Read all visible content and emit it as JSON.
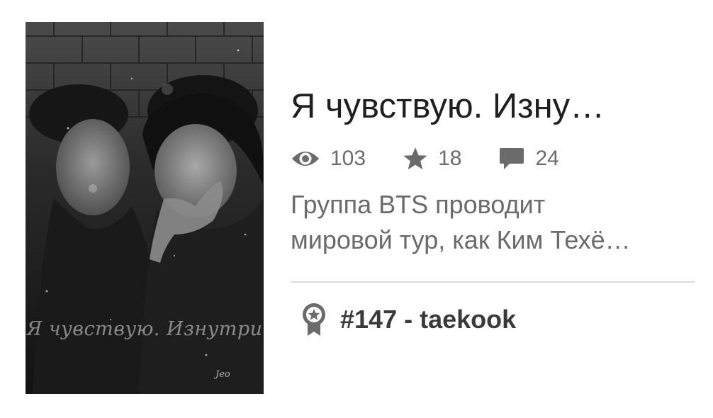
{
  "story": {
    "title": "Я чувствую. Изну…",
    "cover": {
      "title_text": "Я чувствую. Изнутри",
      "signature": "Jeo"
    },
    "stats": {
      "reads": "103",
      "votes": "18",
      "comments": "24"
    },
    "description_lines": [
      "Группа BTS проводит",
      "мировой тур, как Ким Техё…"
    ],
    "ranking": "#147 - taekook"
  },
  "icons": {
    "reads": "eye-icon",
    "votes": "star-icon",
    "comments": "speech-bubble-icon",
    "ranking": "award-badge-icon"
  },
  "colors": {
    "text_primary": "#1f1f1f",
    "text_secondary": "#6b6b6b",
    "divider": "#dcdcdc",
    "ranking_text": "#3a3a3a"
  }
}
